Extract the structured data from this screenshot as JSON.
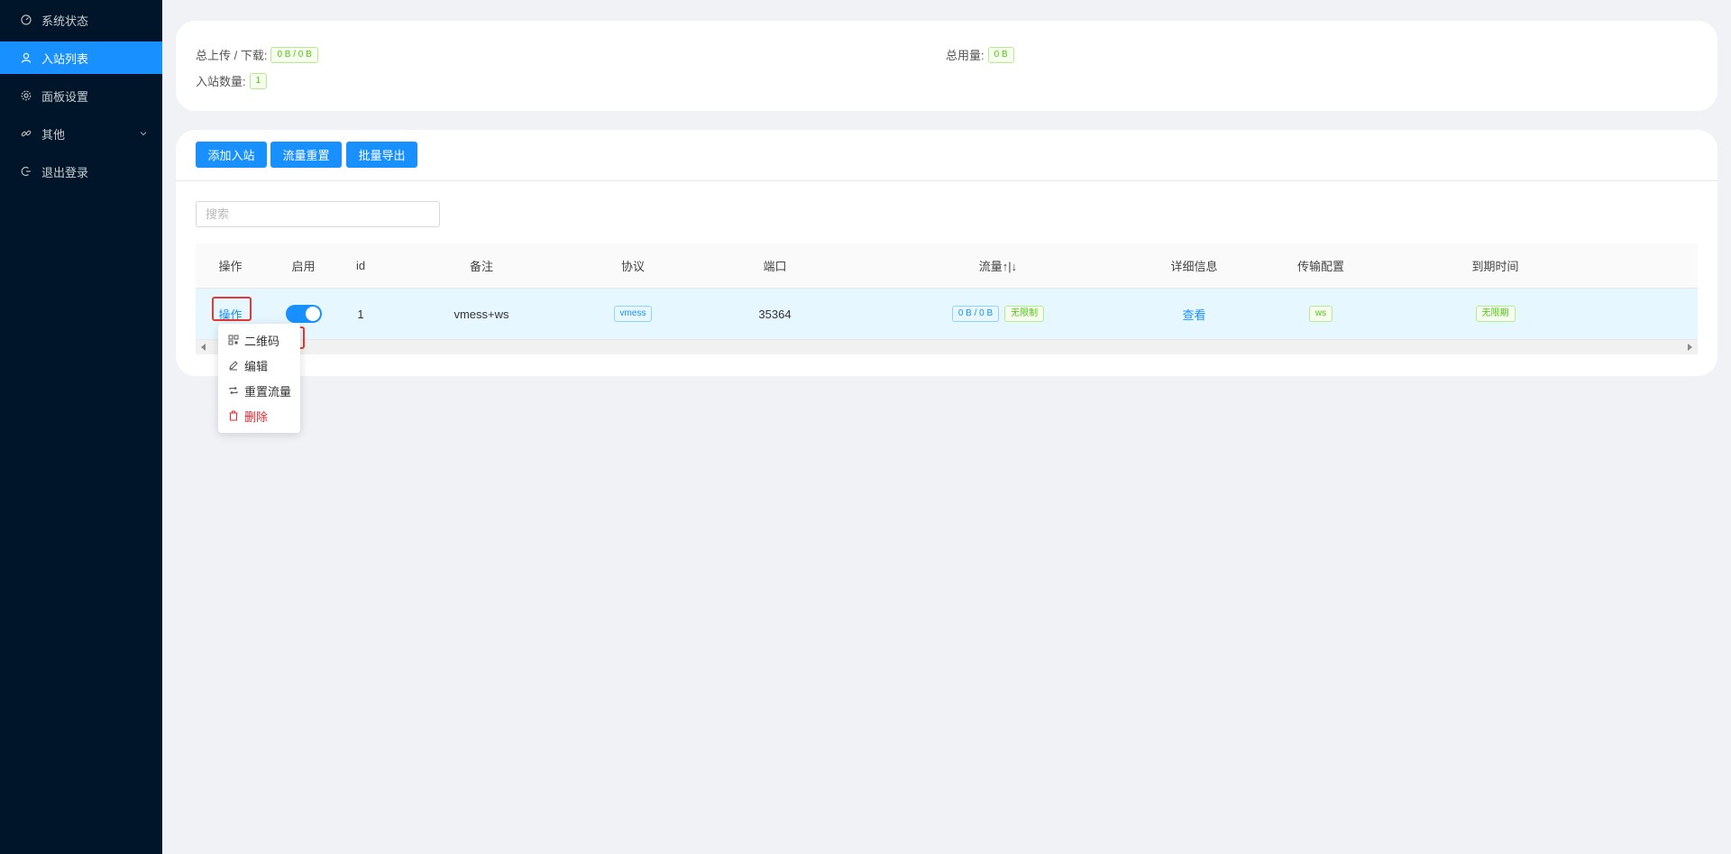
{
  "sidebar": {
    "items": [
      {
        "label": "系统状态",
        "icon": "dashboard-icon"
      },
      {
        "label": "入站列表",
        "icon": "user-icon",
        "active": true
      },
      {
        "label": "面板设置",
        "icon": "gear-icon"
      },
      {
        "label": "其他",
        "icon": "link-icon"
      },
      {
        "label": "退出登录",
        "icon": "logout-icon"
      }
    ]
  },
  "stats": {
    "upload_download_label": "总上传 / 下载:",
    "upload_download_value": "0 B / 0 B",
    "total_usage_label": "总用量:",
    "total_usage_value": "0 B",
    "inbound_count_label": "入站数量:",
    "inbound_count_value": "1"
  },
  "toolbar": {
    "add_inbound": "添加入站",
    "reset_traffic": "流量重置",
    "batch_export": "批量导出"
  },
  "search": {
    "placeholder": "搜索"
  },
  "table": {
    "headers": [
      "操作",
      "启用",
      "id",
      "备注",
      "协议",
      "端口",
      "流量↑|↓",
      "详细信息",
      "传输配置",
      "到期时间"
    ],
    "row": {
      "action": "操作",
      "enabled": true,
      "id": "1",
      "remark": "vmess+ws",
      "protocol": "vmess",
      "port": "35364",
      "traffic": "0 B / 0 B",
      "traffic_limit": "无限制",
      "details": "查看",
      "transport": "ws",
      "expiry": "无限期"
    }
  },
  "dropdown": {
    "items": [
      {
        "label": "二维码",
        "icon": "qrcode-icon"
      },
      {
        "label": "编辑",
        "icon": "edit-icon"
      },
      {
        "label": "重置流量",
        "icon": "retweet-icon"
      },
      {
        "label": "删除",
        "icon": "delete-icon",
        "danger": true
      }
    ]
  },
  "colors": {
    "sidebar_bg": "#001529",
    "primary": "#1890ff",
    "success": "#52c41a",
    "danger": "#f5222d",
    "highlight": "#e53935"
  }
}
